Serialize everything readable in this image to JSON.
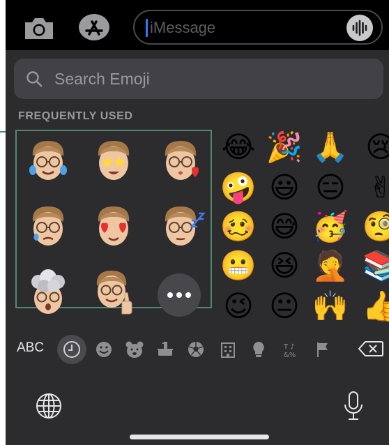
{
  "message_bar": {
    "placeholder": "iMessage"
  },
  "emoji_search": {
    "placeholder": "Search Emoji"
  },
  "section": {
    "title": "FREQUENTLY USED"
  },
  "memoji": [
    {
      "name": "memoji-crying-tears"
    },
    {
      "name": "memoji-star-eyes"
    },
    {
      "name": "memoji-blowing-kiss"
    },
    {
      "name": "memoji-sad-tear"
    },
    {
      "name": "memoji-heart-eyes"
    },
    {
      "name": "memoji-sleeping-zzz"
    },
    {
      "name": "memoji-mind-blown"
    },
    {
      "name": "memoji-thumbs-up"
    }
  ],
  "emoji_grid": [
    [
      "😂",
      "🎉",
      "🙏",
      "😢"
    ],
    [
      "🤪",
      "😃",
      "😑",
      "✌"
    ],
    [
      "🥴",
      "😅",
      "🥳",
      "🧐"
    ],
    [
      "😬",
      "😆",
      "🤦",
      "📚"
    ],
    [
      "😉",
      "😐",
      "🙌",
      "👍"
    ]
  ],
  "category_bar": {
    "abc_label": "ABC",
    "categories": [
      "recents-clock-icon",
      "smileys-icon",
      "animals-icon",
      "food-icon",
      "activity-ball-icon",
      "travel-building-icon",
      "objects-bulb-icon",
      "symbols-icon",
      "flags-icon"
    ]
  },
  "colors": {
    "keyboard_bg": "#2c2c2e",
    "search_bg": "#424246",
    "selection_frame": "#4f8a70",
    "cursor": "#2f7cf6"
  }
}
